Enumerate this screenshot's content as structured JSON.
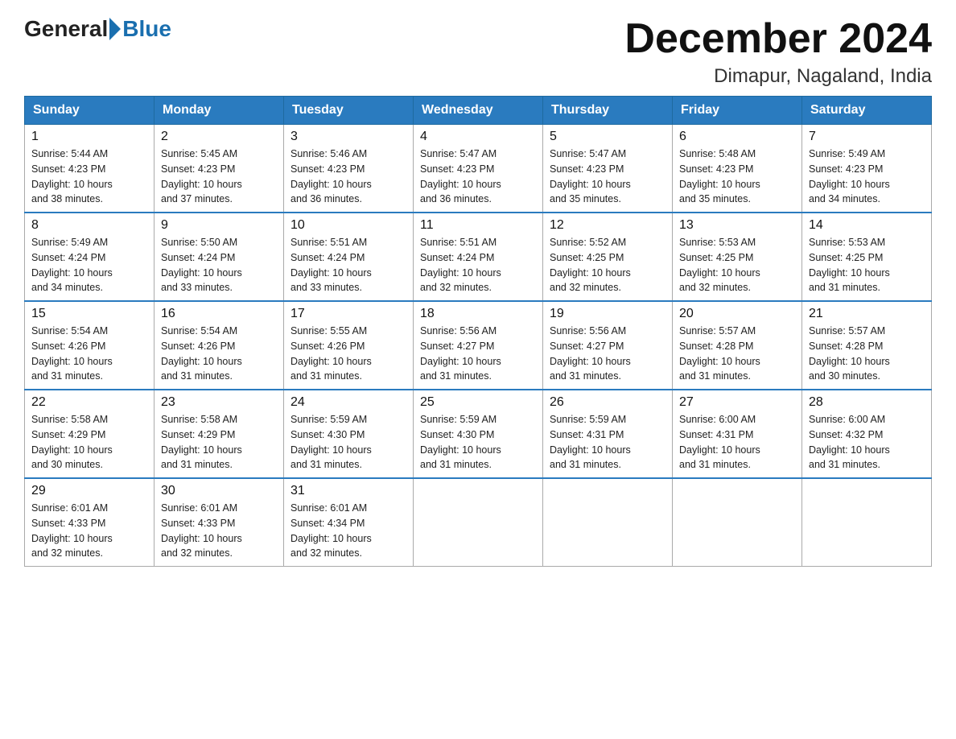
{
  "logo": {
    "general": "General",
    "blue": "Blue"
  },
  "title": "December 2024",
  "location": "Dimapur, Nagaland, India",
  "days_of_week": [
    "Sunday",
    "Monday",
    "Tuesday",
    "Wednesday",
    "Thursday",
    "Friday",
    "Saturday"
  ],
  "weeks": [
    [
      {
        "day": "1",
        "info": "Sunrise: 5:44 AM\nSunset: 4:23 PM\nDaylight: 10 hours\nand 38 minutes."
      },
      {
        "day": "2",
        "info": "Sunrise: 5:45 AM\nSunset: 4:23 PM\nDaylight: 10 hours\nand 37 minutes."
      },
      {
        "day": "3",
        "info": "Sunrise: 5:46 AM\nSunset: 4:23 PM\nDaylight: 10 hours\nand 36 minutes."
      },
      {
        "day": "4",
        "info": "Sunrise: 5:47 AM\nSunset: 4:23 PM\nDaylight: 10 hours\nand 36 minutes."
      },
      {
        "day": "5",
        "info": "Sunrise: 5:47 AM\nSunset: 4:23 PM\nDaylight: 10 hours\nand 35 minutes."
      },
      {
        "day": "6",
        "info": "Sunrise: 5:48 AM\nSunset: 4:23 PM\nDaylight: 10 hours\nand 35 minutes."
      },
      {
        "day": "7",
        "info": "Sunrise: 5:49 AM\nSunset: 4:23 PM\nDaylight: 10 hours\nand 34 minutes."
      }
    ],
    [
      {
        "day": "8",
        "info": "Sunrise: 5:49 AM\nSunset: 4:24 PM\nDaylight: 10 hours\nand 34 minutes."
      },
      {
        "day": "9",
        "info": "Sunrise: 5:50 AM\nSunset: 4:24 PM\nDaylight: 10 hours\nand 33 minutes."
      },
      {
        "day": "10",
        "info": "Sunrise: 5:51 AM\nSunset: 4:24 PM\nDaylight: 10 hours\nand 33 minutes."
      },
      {
        "day": "11",
        "info": "Sunrise: 5:51 AM\nSunset: 4:24 PM\nDaylight: 10 hours\nand 32 minutes."
      },
      {
        "day": "12",
        "info": "Sunrise: 5:52 AM\nSunset: 4:25 PM\nDaylight: 10 hours\nand 32 minutes."
      },
      {
        "day": "13",
        "info": "Sunrise: 5:53 AM\nSunset: 4:25 PM\nDaylight: 10 hours\nand 32 minutes."
      },
      {
        "day": "14",
        "info": "Sunrise: 5:53 AM\nSunset: 4:25 PM\nDaylight: 10 hours\nand 31 minutes."
      }
    ],
    [
      {
        "day": "15",
        "info": "Sunrise: 5:54 AM\nSunset: 4:26 PM\nDaylight: 10 hours\nand 31 minutes."
      },
      {
        "day": "16",
        "info": "Sunrise: 5:54 AM\nSunset: 4:26 PM\nDaylight: 10 hours\nand 31 minutes."
      },
      {
        "day": "17",
        "info": "Sunrise: 5:55 AM\nSunset: 4:26 PM\nDaylight: 10 hours\nand 31 minutes."
      },
      {
        "day": "18",
        "info": "Sunrise: 5:56 AM\nSunset: 4:27 PM\nDaylight: 10 hours\nand 31 minutes."
      },
      {
        "day": "19",
        "info": "Sunrise: 5:56 AM\nSunset: 4:27 PM\nDaylight: 10 hours\nand 31 minutes."
      },
      {
        "day": "20",
        "info": "Sunrise: 5:57 AM\nSunset: 4:28 PM\nDaylight: 10 hours\nand 31 minutes."
      },
      {
        "day": "21",
        "info": "Sunrise: 5:57 AM\nSunset: 4:28 PM\nDaylight: 10 hours\nand 30 minutes."
      }
    ],
    [
      {
        "day": "22",
        "info": "Sunrise: 5:58 AM\nSunset: 4:29 PM\nDaylight: 10 hours\nand 30 minutes."
      },
      {
        "day": "23",
        "info": "Sunrise: 5:58 AM\nSunset: 4:29 PM\nDaylight: 10 hours\nand 31 minutes."
      },
      {
        "day": "24",
        "info": "Sunrise: 5:59 AM\nSunset: 4:30 PM\nDaylight: 10 hours\nand 31 minutes."
      },
      {
        "day": "25",
        "info": "Sunrise: 5:59 AM\nSunset: 4:30 PM\nDaylight: 10 hours\nand 31 minutes."
      },
      {
        "day": "26",
        "info": "Sunrise: 5:59 AM\nSunset: 4:31 PM\nDaylight: 10 hours\nand 31 minutes."
      },
      {
        "day": "27",
        "info": "Sunrise: 6:00 AM\nSunset: 4:31 PM\nDaylight: 10 hours\nand 31 minutes."
      },
      {
        "day": "28",
        "info": "Sunrise: 6:00 AM\nSunset: 4:32 PM\nDaylight: 10 hours\nand 31 minutes."
      }
    ],
    [
      {
        "day": "29",
        "info": "Sunrise: 6:01 AM\nSunset: 4:33 PM\nDaylight: 10 hours\nand 32 minutes."
      },
      {
        "day": "30",
        "info": "Sunrise: 6:01 AM\nSunset: 4:33 PM\nDaylight: 10 hours\nand 32 minutes."
      },
      {
        "day": "31",
        "info": "Sunrise: 6:01 AM\nSunset: 4:34 PM\nDaylight: 10 hours\nand 32 minutes."
      },
      null,
      null,
      null,
      null
    ]
  ]
}
